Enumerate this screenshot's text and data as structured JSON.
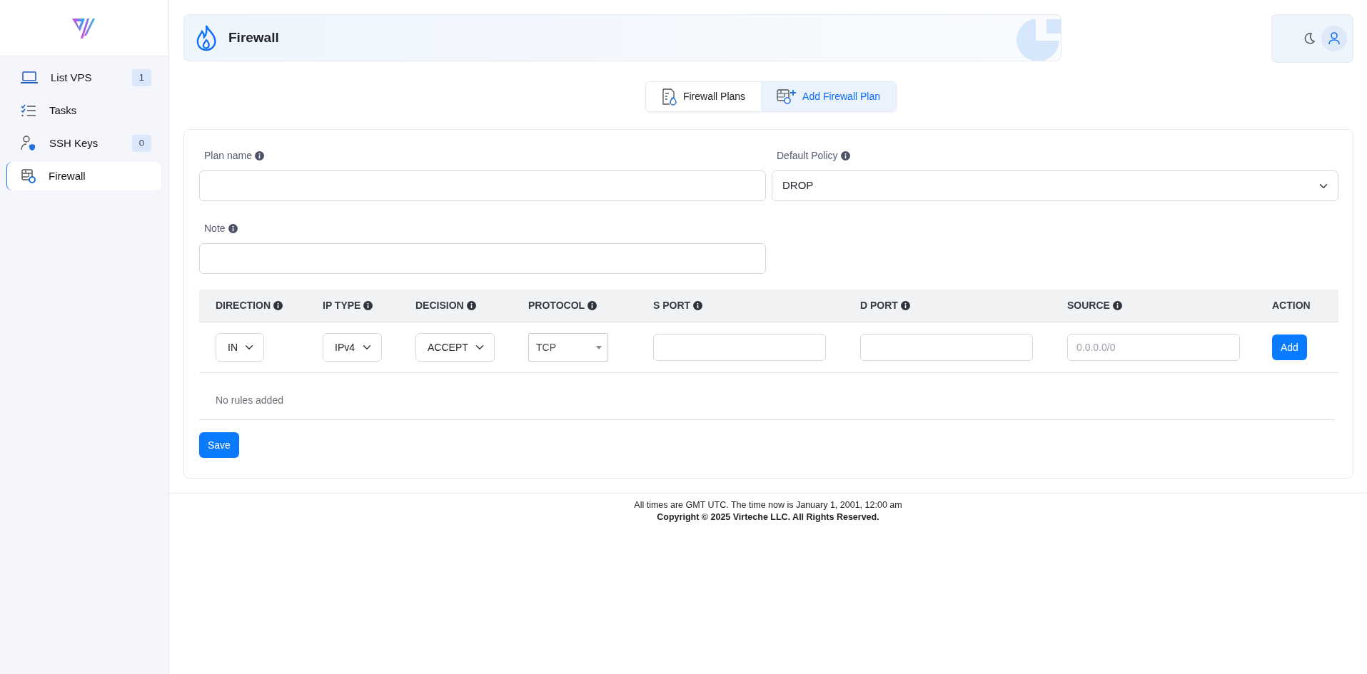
{
  "sidebar": {
    "items": [
      {
        "label": "List VPS",
        "badge": "1",
        "selected": false
      },
      {
        "label": "Tasks",
        "selected": false
      },
      {
        "label": "SSH Keys",
        "badge": "0",
        "selected": false
      },
      {
        "label": "Firewall",
        "selected": true
      }
    ]
  },
  "header": {
    "title": "Firewall"
  },
  "tabs": [
    {
      "label": "Firewall Plans",
      "selected": false
    },
    {
      "label": "Add Firewall Plan",
      "selected": true
    }
  ],
  "form": {
    "fields": [
      {
        "kind": "input",
        "label": "Plan name",
        "info": true
      },
      {
        "kind": "select",
        "label": "Default Policy",
        "info": true,
        "value": "DROP"
      },
      {
        "kind": "input",
        "label": "Note",
        "info": true
      }
    ]
  },
  "table": {
    "columns": [
      {
        "label": "DIRECTION",
        "info": true
      },
      {
        "label": "IP TYPE",
        "info": true
      },
      {
        "label": "DECISION",
        "info": true
      },
      {
        "label": "PROTOCOL",
        "info": true
      },
      {
        "label": "S PORT",
        "info": true
      },
      {
        "label": "D PORT",
        "info": true
      },
      {
        "label": "SOURCE",
        "info": true
      },
      {
        "label": "ACTION",
        "info": false
      }
    ],
    "entry_row": [
      {
        "kind": "select",
        "value": "IN"
      },
      {
        "kind": "select",
        "value": "IPv4"
      },
      {
        "kind": "select",
        "value": "ACCEPT"
      },
      {
        "kind": "combo",
        "value": "TCP"
      },
      {
        "kind": "input"
      },
      {
        "kind": "input"
      },
      {
        "kind": "input",
        "placeholder": "0.0.0.0/0"
      },
      {
        "kind": "button",
        "label": "Add"
      }
    ],
    "empty_message": "No rules added"
  },
  "save_button": "Save",
  "footer": {
    "time_note": "All times are GMT UTC. The time now is January 1, 2001, 12:00 am",
    "copyright": "Copyright © 2025 Virteche LLC. All Rights Reserved."
  }
}
